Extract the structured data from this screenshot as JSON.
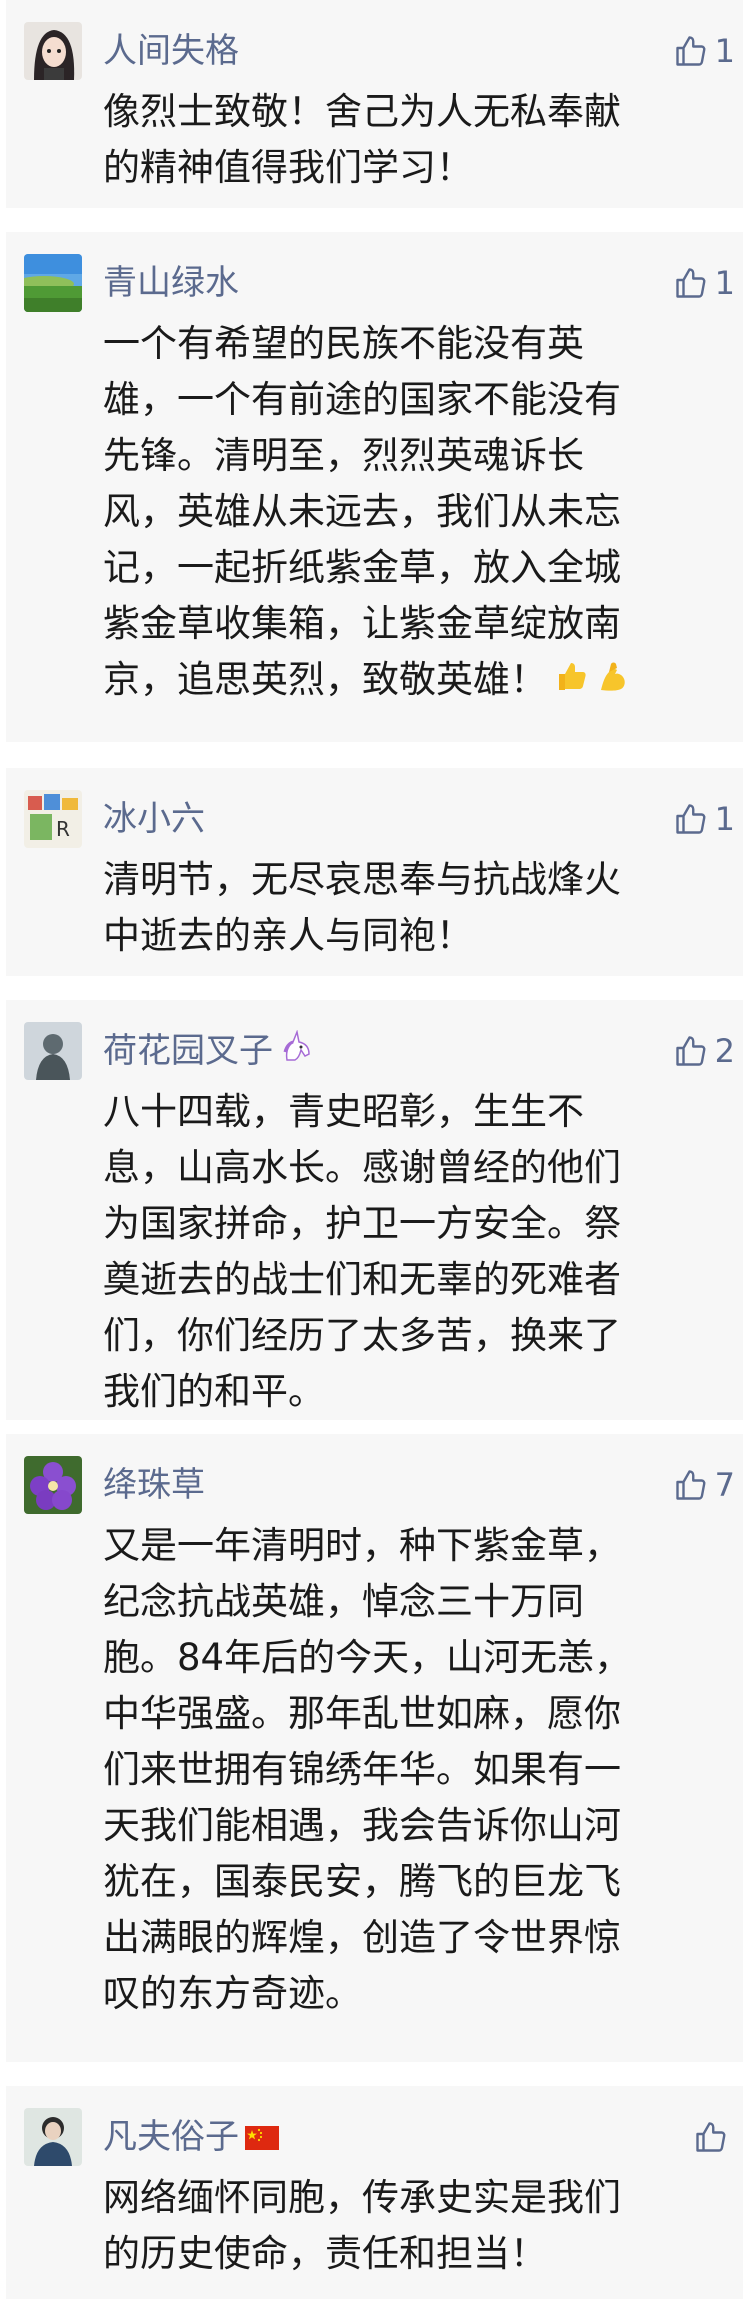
{
  "comments": [
    {
      "name": "人间失格",
      "likes": "1",
      "lines": [
        "像烈士致敬！舍己为人无私奉献",
        "的精神值得我们学习！"
      ]
    },
    {
      "name": "青山绿水",
      "likes": "1",
      "lines": [
        "一个有希望的民族不能没有英",
        "雄，一个有前途的国家不能没有",
        "先锋。清明至，烈烈英魂诉长",
        "风，英雄从未远去，我们从未忘",
        "记，一起折纸紫金草，放入全城",
        "紫金草收集箱，让紫金草绽放南",
        "京，追思英烈，致敬英雄！"
      ]
    },
    {
      "name": "冰小六",
      "likes": "1",
      "lines": [
        "清明节，无尽哀思奉与抗战烽火",
        "中逝去的亲人与同袍！"
      ]
    },
    {
      "name": "荷花园叉子",
      "likes": "2",
      "lines": [
        "八十四载，青史昭彰，生生不",
        "息，山高水长。感谢曾经的他们",
        "为国家拼命，护卫一方安全。祭",
        "奠逝去的战士们和无辜的死难者",
        "们，你们经历了太多苦，换来了",
        "我们的和平。"
      ]
    },
    {
      "name": "绛珠草",
      "likes": "7",
      "lines": [
        "又是一年清明时，种下紫金草，",
        "纪念抗战英雄，悼念三十万同",
        "胞。84年后的今天，山河无恙，",
        "中华强盛。那年乱世如麻，愿你",
        "们来世拥有锦绣年华。如果有一",
        "天我们能相遇，我会告诉你山河",
        "犹在，国泰民安，腾飞的巨龙飞",
        "出满眼的辉煌，创造了令世界惊",
        "叹的东方奇迹。"
      ]
    },
    {
      "name": "凡夫俗子",
      "likes": "",
      "lines": [
        "网络缅怀同胞，传承史实是我们",
        "的历史使命，责任和担当！"
      ]
    }
  ],
  "icon_color": "#5b6a8e"
}
